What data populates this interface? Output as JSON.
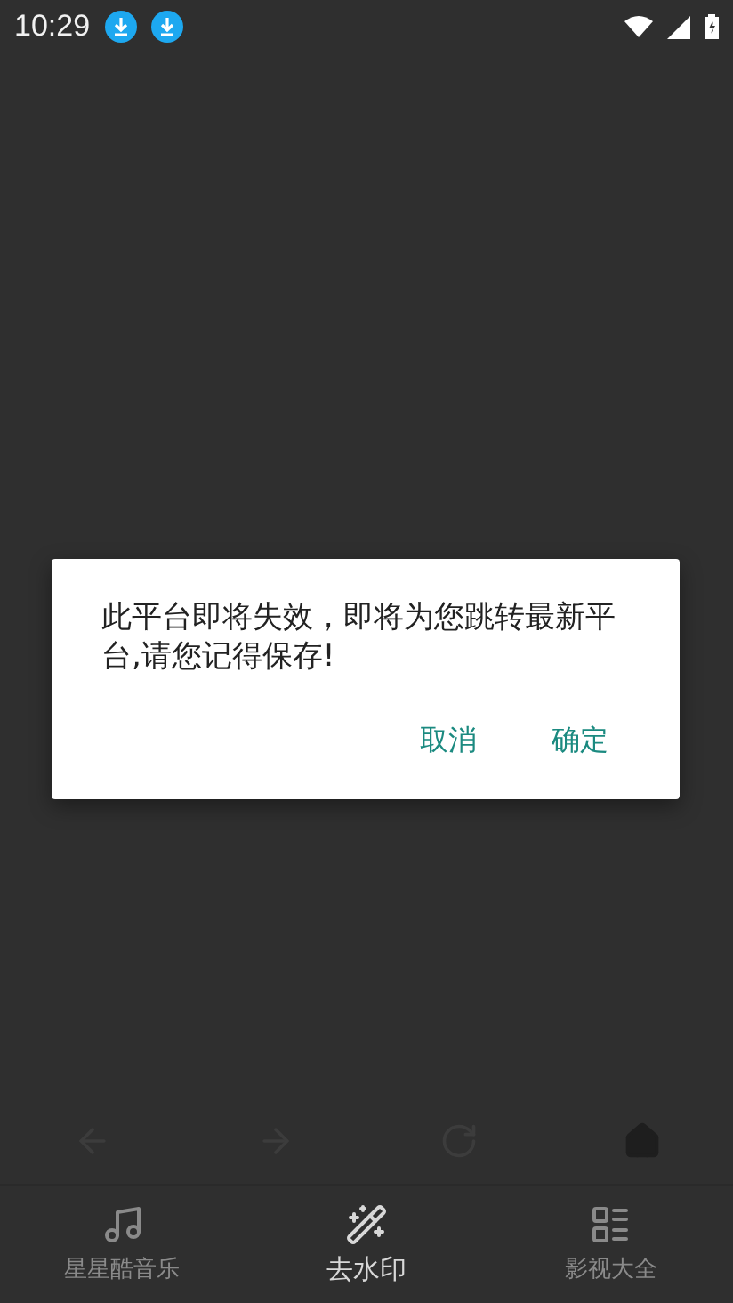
{
  "status_bar": {
    "time": "10:29",
    "notifications": [
      {
        "kind": "download"
      },
      {
        "kind": "download"
      }
    ]
  },
  "toolbar": {
    "buttons": [
      {
        "kind": "back"
      },
      {
        "kind": "forward"
      },
      {
        "kind": "reload"
      },
      {
        "kind": "home"
      }
    ]
  },
  "bottom_nav": [
    {
      "label": "星星酷音乐",
      "kind": "music",
      "selected": false
    },
    {
      "label": "去水印",
      "kind": "wand",
      "selected": true
    },
    {
      "label": "影视大全",
      "kind": "list",
      "selected": false
    }
  ],
  "dialog": {
    "message": "此平台即将失效，即将为您跳转最新平台,请您记得保存!",
    "buttons": [
      {
        "label": "取消"
      },
      {
        "label": "确定"
      }
    ]
  }
}
